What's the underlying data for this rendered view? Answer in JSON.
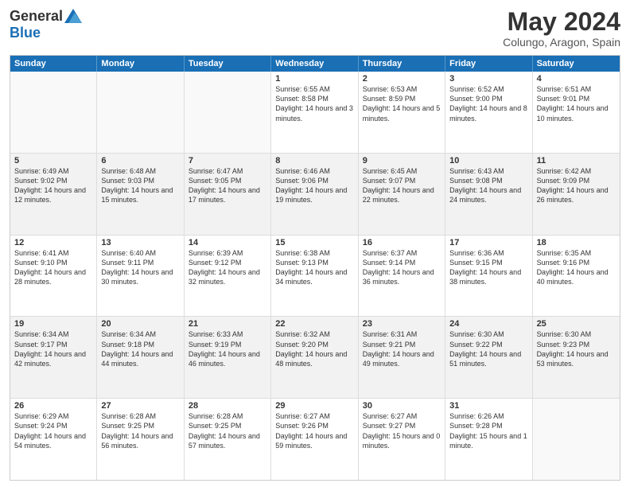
{
  "header": {
    "logo_general": "General",
    "logo_blue": "Blue",
    "month_title": "May 2024",
    "location": "Colungo, Aragon, Spain"
  },
  "weekdays": [
    "Sunday",
    "Monday",
    "Tuesday",
    "Wednesday",
    "Thursday",
    "Friday",
    "Saturday"
  ],
  "rows": [
    [
      {
        "day": "",
        "sunrise": "",
        "sunset": "",
        "daylight": ""
      },
      {
        "day": "",
        "sunrise": "",
        "sunset": "",
        "daylight": ""
      },
      {
        "day": "",
        "sunrise": "",
        "sunset": "",
        "daylight": ""
      },
      {
        "day": "1",
        "sunrise": "Sunrise: 6:55 AM",
        "sunset": "Sunset: 8:58 PM",
        "daylight": "Daylight: 14 hours and 3 minutes."
      },
      {
        "day": "2",
        "sunrise": "Sunrise: 6:53 AM",
        "sunset": "Sunset: 8:59 PM",
        "daylight": "Daylight: 14 hours and 5 minutes."
      },
      {
        "day": "3",
        "sunrise": "Sunrise: 6:52 AM",
        "sunset": "Sunset: 9:00 PM",
        "daylight": "Daylight: 14 hours and 8 minutes."
      },
      {
        "day": "4",
        "sunrise": "Sunrise: 6:51 AM",
        "sunset": "Sunset: 9:01 PM",
        "daylight": "Daylight: 14 hours and 10 minutes."
      }
    ],
    [
      {
        "day": "5",
        "sunrise": "Sunrise: 6:49 AM",
        "sunset": "Sunset: 9:02 PM",
        "daylight": "Daylight: 14 hours and 12 minutes."
      },
      {
        "day": "6",
        "sunrise": "Sunrise: 6:48 AM",
        "sunset": "Sunset: 9:03 PM",
        "daylight": "Daylight: 14 hours and 15 minutes."
      },
      {
        "day": "7",
        "sunrise": "Sunrise: 6:47 AM",
        "sunset": "Sunset: 9:05 PM",
        "daylight": "Daylight: 14 hours and 17 minutes."
      },
      {
        "day": "8",
        "sunrise": "Sunrise: 6:46 AM",
        "sunset": "Sunset: 9:06 PM",
        "daylight": "Daylight: 14 hours and 19 minutes."
      },
      {
        "day": "9",
        "sunrise": "Sunrise: 6:45 AM",
        "sunset": "Sunset: 9:07 PM",
        "daylight": "Daylight: 14 hours and 22 minutes."
      },
      {
        "day": "10",
        "sunrise": "Sunrise: 6:43 AM",
        "sunset": "Sunset: 9:08 PM",
        "daylight": "Daylight: 14 hours and 24 minutes."
      },
      {
        "day": "11",
        "sunrise": "Sunrise: 6:42 AM",
        "sunset": "Sunset: 9:09 PM",
        "daylight": "Daylight: 14 hours and 26 minutes."
      }
    ],
    [
      {
        "day": "12",
        "sunrise": "Sunrise: 6:41 AM",
        "sunset": "Sunset: 9:10 PM",
        "daylight": "Daylight: 14 hours and 28 minutes."
      },
      {
        "day": "13",
        "sunrise": "Sunrise: 6:40 AM",
        "sunset": "Sunset: 9:11 PM",
        "daylight": "Daylight: 14 hours and 30 minutes."
      },
      {
        "day": "14",
        "sunrise": "Sunrise: 6:39 AM",
        "sunset": "Sunset: 9:12 PM",
        "daylight": "Daylight: 14 hours and 32 minutes."
      },
      {
        "day": "15",
        "sunrise": "Sunrise: 6:38 AM",
        "sunset": "Sunset: 9:13 PM",
        "daylight": "Daylight: 14 hours and 34 minutes."
      },
      {
        "day": "16",
        "sunrise": "Sunrise: 6:37 AM",
        "sunset": "Sunset: 9:14 PM",
        "daylight": "Daylight: 14 hours and 36 minutes."
      },
      {
        "day": "17",
        "sunrise": "Sunrise: 6:36 AM",
        "sunset": "Sunset: 9:15 PM",
        "daylight": "Daylight: 14 hours and 38 minutes."
      },
      {
        "day": "18",
        "sunrise": "Sunrise: 6:35 AM",
        "sunset": "Sunset: 9:16 PM",
        "daylight": "Daylight: 14 hours and 40 minutes."
      }
    ],
    [
      {
        "day": "19",
        "sunrise": "Sunrise: 6:34 AM",
        "sunset": "Sunset: 9:17 PM",
        "daylight": "Daylight: 14 hours and 42 minutes."
      },
      {
        "day": "20",
        "sunrise": "Sunrise: 6:34 AM",
        "sunset": "Sunset: 9:18 PM",
        "daylight": "Daylight: 14 hours and 44 minutes."
      },
      {
        "day": "21",
        "sunrise": "Sunrise: 6:33 AM",
        "sunset": "Sunset: 9:19 PM",
        "daylight": "Daylight: 14 hours and 46 minutes."
      },
      {
        "day": "22",
        "sunrise": "Sunrise: 6:32 AM",
        "sunset": "Sunset: 9:20 PM",
        "daylight": "Daylight: 14 hours and 48 minutes."
      },
      {
        "day": "23",
        "sunrise": "Sunrise: 6:31 AM",
        "sunset": "Sunset: 9:21 PM",
        "daylight": "Daylight: 14 hours and 49 minutes."
      },
      {
        "day": "24",
        "sunrise": "Sunrise: 6:30 AM",
        "sunset": "Sunset: 9:22 PM",
        "daylight": "Daylight: 14 hours and 51 minutes."
      },
      {
        "day": "25",
        "sunrise": "Sunrise: 6:30 AM",
        "sunset": "Sunset: 9:23 PM",
        "daylight": "Daylight: 14 hours and 53 minutes."
      }
    ],
    [
      {
        "day": "26",
        "sunrise": "Sunrise: 6:29 AM",
        "sunset": "Sunset: 9:24 PM",
        "daylight": "Daylight: 14 hours and 54 minutes."
      },
      {
        "day": "27",
        "sunrise": "Sunrise: 6:28 AM",
        "sunset": "Sunset: 9:25 PM",
        "daylight": "Daylight: 14 hours and 56 minutes."
      },
      {
        "day": "28",
        "sunrise": "Sunrise: 6:28 AM",
        "sunset": "Sunset: 9:25 PM",
        "daylight": "Daylight: 14 hours and 57 minutes."
      },
      {
        "day": "29",
        "sunrise": "Sunrise: 6:27 AM",
        "sunset": "Sunset: 9:26 PM",
        "daylight": "Daylight: 14 hours and 59 minutes."
      },
      {
        "day": "30",
        "sunrise": "Sunrise: 6:27 AM",
        "sunset": "Sunset: 9:27 PM",
        "daylight": "Daylight: 15 hours and 0 minutes."
      },
      {
        "day": "31",
        "sunrise": "Sunrise: 6:26 AM",
        "sunset": "Sunset: 9:28 PM",
        "daylight": "Daylight: 15 hours and 1 minute."
      },
      {
        "day": "",
        "sunrise": "",
        "sunset": "",
        "daylight": ""
      }
    ]
  ]
}
